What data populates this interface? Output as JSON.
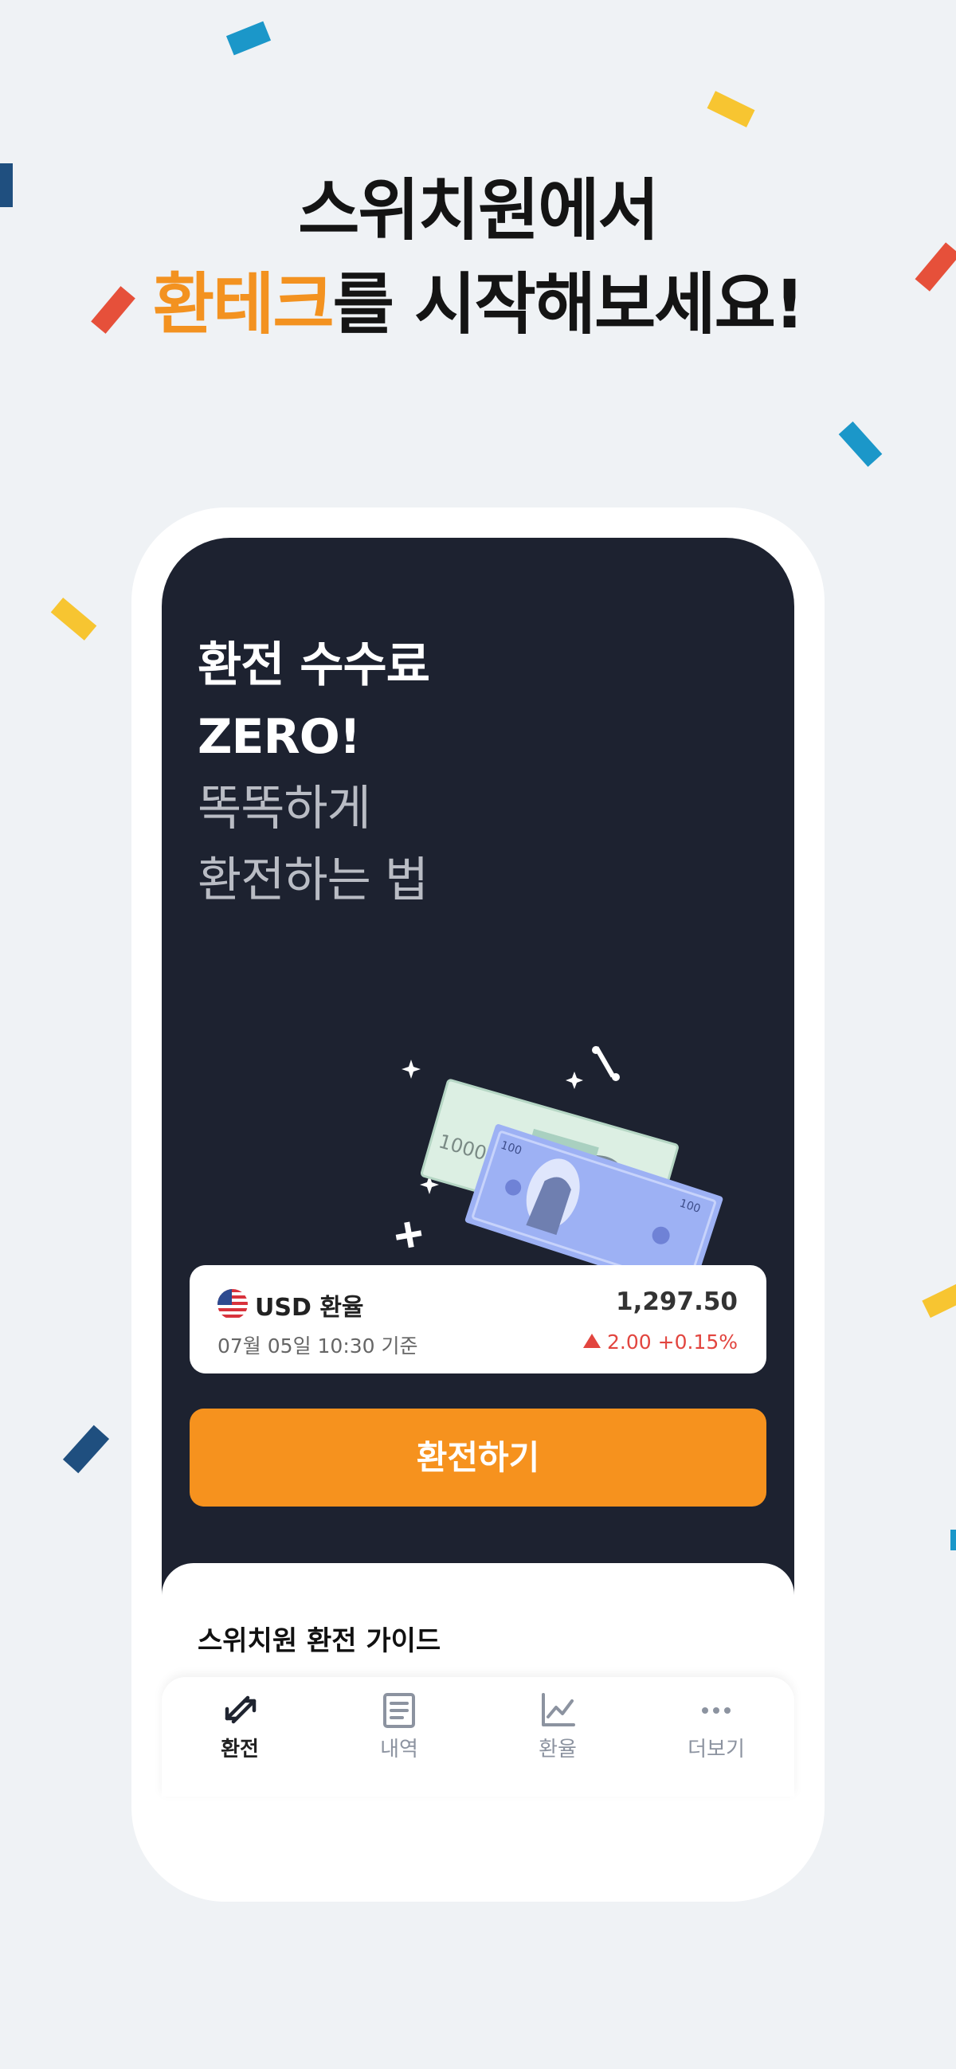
{
  "headline": {
    "line1": "스위치원에서",
    "line2_accent": "환테크",
    "line2_rest": "를 시작해보세요!"
  },
  "promo": {
    "line1": "환전 수수료",
    "line2": "ZERO!",
    "line3": "똑똑하게",
    "line4": "환전하는 법"
  },
  "illustration": {
    "note_krw": "10000",
    "note_usd": "100"
  },
  "rate_card": {
    "title": "USD 환율",
    "timestamp": "07월 05일 10:30 기준",
    "value": "1,297.50",
    "change": "2.00 +0.15%"
  },
  "exchange_button": {
    "label": "환전하기"
  },
  "guide": {
    "title": "스위치원 환전 가이드"
  },
  "tabs": [
    {
      "label": "환전",
      "icon": "exchange-arrows-icon",
      "active": true
    },
    {
      "label": "내역",
      "icon": "document-icon",
      "active": false
    },
    {
      "label": "환율",
      "icon": "chart-icon",
      "active": false
    },
    {
      "label": "더보기",
      "icon": "more-dots-icon",
      "active": false
    }
  ],
  "colors": {
    "accent": "#f6921e",
    "dark_bg": "#1d2230",
    "change_up": "#e2453f",
    "page_bg": "#eff2f5"
  }
}
